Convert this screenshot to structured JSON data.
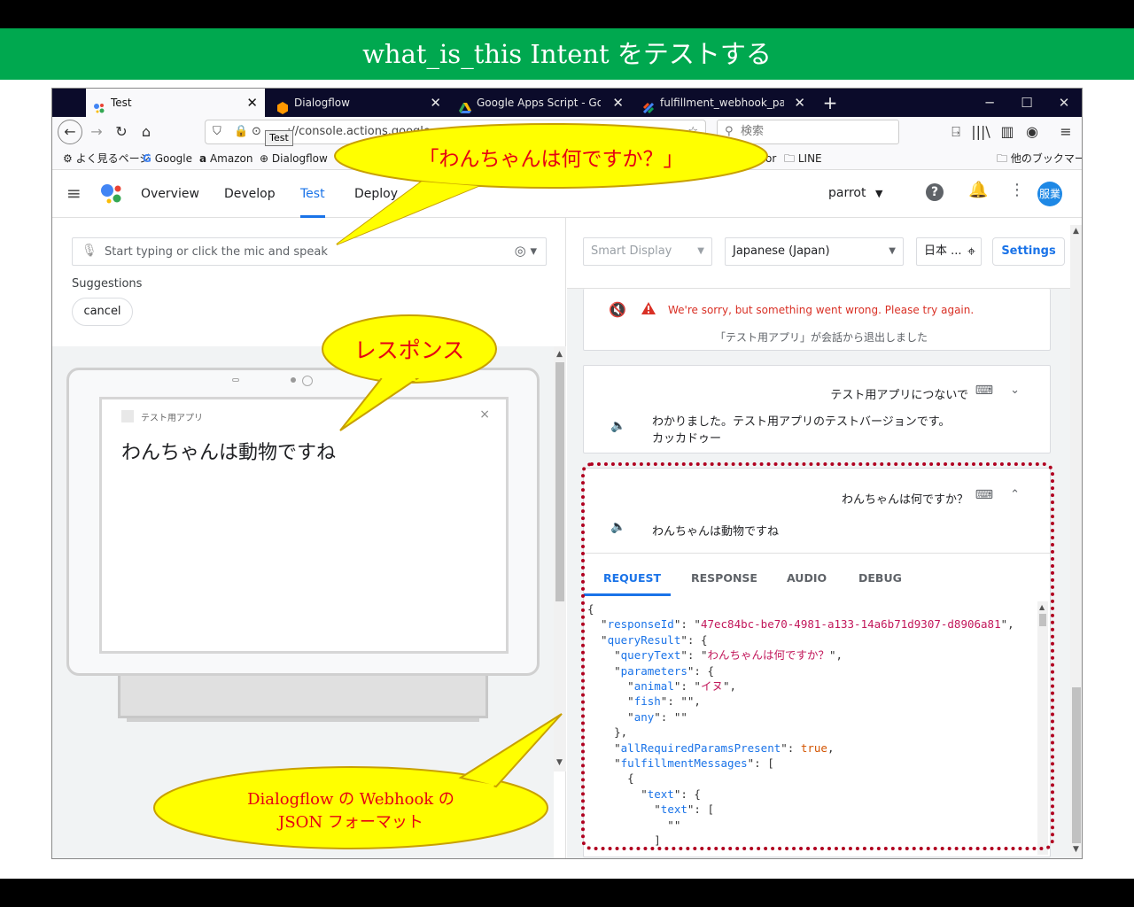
{
  "slide": {
    "title": "what_is_this Intent をテストする"
  },
  "browser": {
    "tabs": [
      {
        "label": "Test",
        "active": true
      },
      {
        "label": "Dialogflow",
        "active": false
      },
      {
        "label": "Google Apps Script - Google ドライブ",
        "active": false
      },
      {
        "label": "fulfillment_webhook_parrot - プロジェクト",
        "active": false
      }
    ],
    "new_tab": "+",
    "url": "://console.actions.google.com",
    "tooltip": "Test",
    "search_placeholder": "検索",
    "bookmarks": [
      "よく見るページ",
      "Google",
      "Amazon",
      "Dialogflow",
      "or",
      "LINE",
      "他のブックマーク"
    ]
  },
  "app": {
    "nav": [
      "Overview",
      "Develop",
      "Test",
      "Deploy"
    ],
    "project": "parrot",
    "avatar": "服業",
    "input_placeholder": "Start typing or click the mic and speak",
    "suggestions_label": "Suggestions",
    "suggestion_chip": "cancel",
    "device_app_name": "テスト用アプリ",
    "device_close": "×",
    "device_response": "わんちゃんは動物ですね",
    "surface": "Smart Display",
    "language": "Japanese (Japan)",
    "locale": "日本 ...",
    "settings": "Settings",
    "error_text": "We're sorry, but something went wrong. Please try again.",
    "exit_text": "「テスト用アプリ」が会話から退出しました",
    "user_query_1": "テスト用アプリにつないで",
    "agent_reply_1_line1": "わかりました。テスト用アプリのテストバージョンです。",
    "agent_reply_1_line2": "カッカドゥー",
    "user_query_2": "わんちゃんは何ですか？",
    "agent_reply_2": "わんちゃんは動物ですね",
    "tabs": [
      "REQUEST",
      "RESPONSE",
      "AUDIO",
      "DEBUG"
    ],
    "json": {
      "responseId_key": "responseId",
      "responseId_val": "47ec84bc-be70-4981-a133-14a6b71d9307-d8906a81",
      "queryResult_key": "queryResult",
      "queryText_key": "queryText",
      "queryText_val": "わんちゃんは何ですか？",
      "parameters_key": "parameters",
      "animal_key": "animal",
      "animal_val": "イヌ",
      "fish_key": "fish",
      "fish_val": "",
      "any_key": "any",
      "any_val": "",
      "allReq_key": "allRequiredParamsPresent",
      "allReq_val": "true",
      "fm_key": "fulfillmentMessages",
      "text_key": "text"
    }
  },
  "callouts": {
    "question": "「わんちゃんは何ですか？」",
    "response": "レスポンス",
    "webhook_line1": "Dialogflow の Webhook の",
    "webhook_line2": "JSON フォーマット"
  }
}
